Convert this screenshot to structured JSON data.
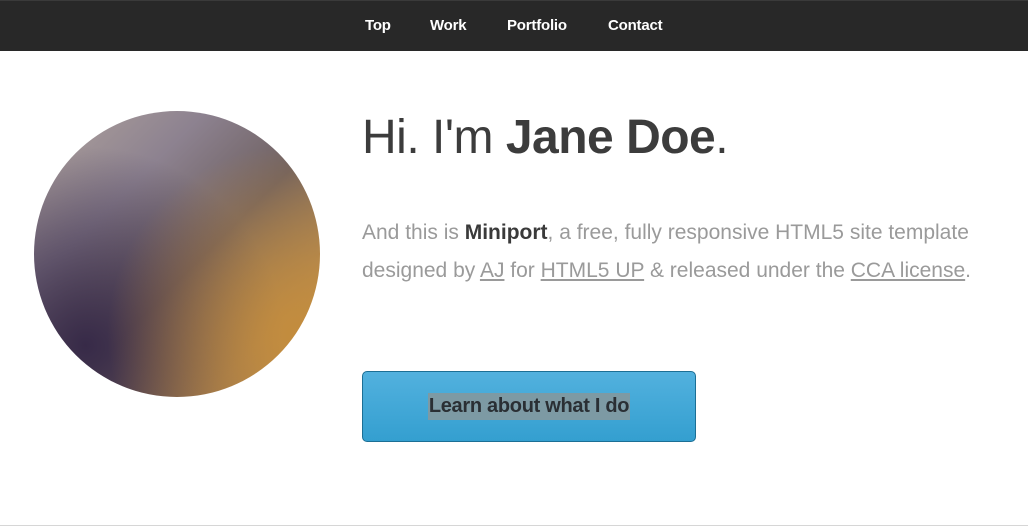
{
  "nav": {
    "items": [
      {
        "label": "Top"
      },
      {
        "label": "Work"
      },
      {
        "label": "Portfolio"
      },
      {
        "label": "Contact"
      }
    ]
  },
  "hero": {
    "greeting": "Hi. I'm ",
    "name": "Jane Doe",
    "period": ".",
    "intro": {
      "part1": "And this is ",
      "brand": "Miniport",
      "part2": ", a free, fully responsive HTML5 site template designed by ",
      "link_author": "AJ",
      "part3": " for ",
      "link_html5up": "HTML5 UP",
      "part4": " & released under the ",
      "link_license": "CCA license",
      "part5": "."
    },
    "cta_label": "Learn about what I do"
  },
  "colors": {
    "nav_bg": "#282828",
    "nav_text": "#ffffff",
    "cta_bg": "#3ea7d8",
    "body_text": "#9a9a9a",
    "heading_text": "#3c3c3c"
  }
}
